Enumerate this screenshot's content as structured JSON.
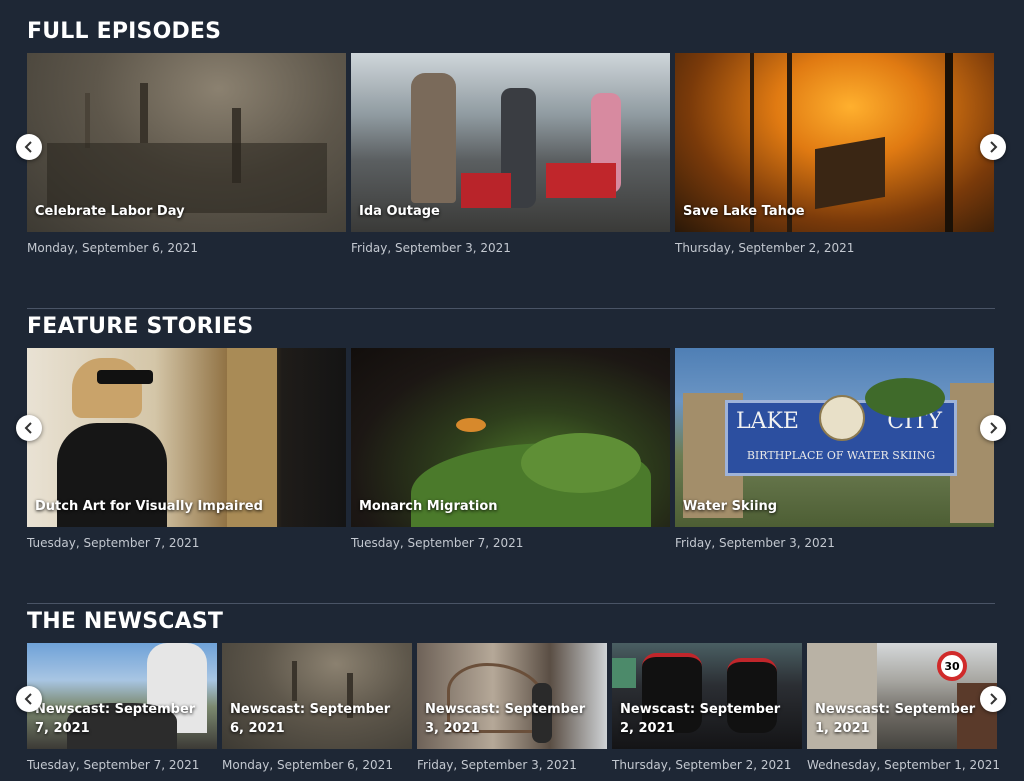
{
  "sections": {
    "full_episodes": {
      "title": "FULL EPISODES",
      "cards": [
        {
          "title": "Celebrate Labor Day",
          "date": "Monday, September 6, 2021"
        },
        {
          "title": "Ida Outage",
          "date": "Friday, September 3, 2021"
        },
        {
          "title": "Save Lake Tahoe",
          "date": "Thursday, September 2, 2021"
        }
      ]
    },
    "feature_stories": {
      "title": "FEATURE STORIES",
      "cards": [
        {
          "title": "Dutch Art for Visually Impaired",
          "date": "Tuesday, September 7, 2021"
        },
        {
          "title": "Monarch Migration",
          "date": "Tuesday, September 7, 2021"
        },
        {
          "title": "Water Skiing",
          "date": "Friday, September 3, 2021"
        }
      ]
    },
    "newscast": {
      "title": "THE NEWSCAST",
      "cards": [
        {
          "title": "Newscast: September 7, 2021",
          "date": "Tuesday, September 7, 2021"
        },
        {
          "title": "Newscast: September 6, 2021",
          "date": "Monday, September 6, 2021"
        },
        {
          "title": "Newscast: September 3, 2021",
          "date": "Friday, September 3, 2021"
        },
        {
          "title": "Newscast: September 2, 2021",
          "date": "Thursday, September 2, 2021"
        },
        {
          "title": "Newscast: September 1, 2021",
          "date": "Wednesday, September 1, 2021"
        }
      ]
    }
  },
  "image_text": {
    "lake_city_sign_line1": "LAKE",
    "lake_city_sign_line2": "CITY",
    "lake_city_sign_sub": "BIRTHPLACE OF WATER SKIING",
    "speed_sign": "30"
  },
  "icons": {
    "prev": "chevron-left-icon",
    "next": "chevron-right-icon"
  },
  "colors": {
    "background": "#1e2735",
    "divider": "#4a5466",
    "date_text": "#c3c8d0"
  }
}
